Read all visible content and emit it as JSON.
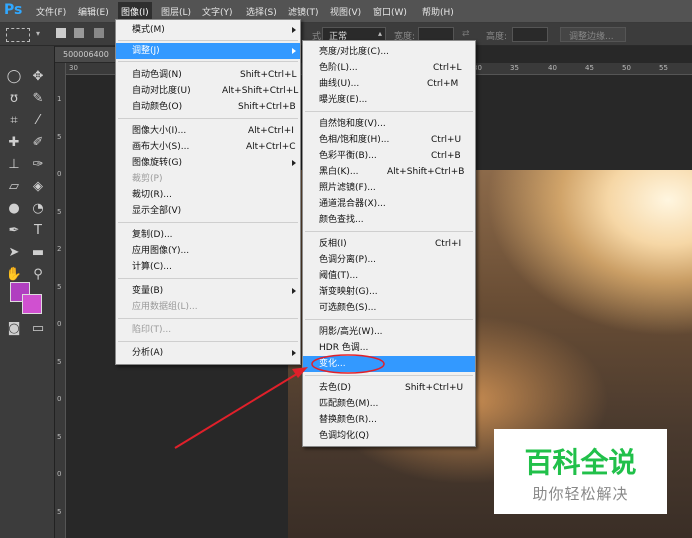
{
  "app": {
    "logo": "Ps"
  },
  "menubar": [
    {
      "label": "文件(F)"
    },
    {
      "label": "编辑(E)"
    },
    {
      "label": "图像(I)"
    },
    {
      "label": "图层(L)"
    },
    {
      "label": "文字(Y)"
    },
    {
      "label": "选择(S)"
    },
    {
      "label": "滤镜(T)"
    },
    {
      "label": "视图(V)"
    },
    {
      "label": "窗口(W)"
    },
    {
      "label": "帮助(H)"
    }
  ],
  "options_bar": {
    "mode_prefix": "式:",
    "mode_value": "正常",
    "width_label": "宽度:",
    "height_label": "高度:",
    "refine_edge": "调整边缘..."
  },
  "document": {
    "tab": "500006400"
  },
  "ruler_h": [
    "30",
    "25",
    "30",
    "35",
    "40",
    "45",
    "50",
    "55"
  ],
  "ruler_v": [
    "1",
    "5",
    "0",
    "5",
    "2",
    "0",
    "5",
    "1",
    "0",
    "1",
    "5",
    "2",
    "0",
    "2",
    "5",
    "3",
    "0",
    "3",
    "5",
    "4",
    "0",
    "4",
    "5",
    "5"
  ],
  "image_menu": {
    "items": [
      {
        "label": "模式(M)",
        "submenu": true
      },
      {
        "label": "调整(J)",
        "submenu": true,
        "highlight": true
      },
      {
        "label": "自动色调(N)",
        "shortcut": "Shift+Ctrl+L"
      },
      {
        "label": "自动对比度(U)",
        "shortcut": "Alt+Shift+Ctrl+L"
      },
      {
        "label": "自动颜色(O)",
        "shortcut": "Shift+Ctrl+B"
      },
      {
        "label": "图像大小(I)...",
        "shortcut": "Alt+Ctrl+I"
      },
      {
        "label": "画布大小(S)...",
        "shortcut": "Alt+Ctrl+C"
      },
      {
        "label": "图像旋转(G)",
        "submenu": true
      },
      {
        "label": "裁剪(P)",
        "disabled": true
      },
      {
        "label": "裁切(R)..."
      },
      {
        "label": "显示全部(V)"
      },
      {
        "label": "复制(D)..."
      },
      {
        "label": "应用图像(Y)..."
      },
      {
        "label": "计算(C)..."
      },
      {
        "label": "变量(B)",
        "submenu": true
      },
      {
        "label": "应用数据组(L)...",
        "disabled": true
      },
      {
        "label": "陷印(T)...",
        "disabled": true
      },
      {
        "label": "分析(A)",
        "submenu": true
      }
    ]
  },
  "adjust_menu": {
    "items": [
      {
        "label": "亮度/对比度(C)..."
      },
      {
        "label": "色阶(L)...",
        "shortcut": "Ctrl+L"
      },
      {
        "label": "曲线(U)...",
        "shortcut": "Ctrl+M"
      },
      {
        "label": "曝光度(E)..."
      },
      {
        "label": "自然饱和度(V)..."
      },
      {
        "label": "色相/饱和度(H)...",
        "shortcut": "Ctrl+U"
      },
      {
        "label": "色彩平衡(B)...",
        "shortcut": "Ctrl+B"
      },
      {
        "label": "黑白(K)...",
        "shortcut": "Alt+Shift+Ctrl+B"
      },
      {
        "label": "照片滤镜(F)..."
      },
      {
        "label": "通道混合器(X)..."
      },
      {
        "label": "颜色查找..."
      },
      {
        "label": "反相(I)",
        "shortcut": "Ctrl+I"
      },
      {
        "label": "色调分离(P)..."
      },
      {
        "label": "阈值(T)..."
      },
      {
        "label": "渐变映射(G)..."
      },
      {
        "label": "可选颜色(S)..."
      },
      {
        "label": "阴影/高光(W)..."
      },
      {
        "label": "HDR 色调..."
      },
      {
        "label": "变化...",
        "highlight": true
      },
      {
        "label": "去色(D)",
        "shortcut": "Shift+Ctrl+U"
      },
      {
        "label": "匹配颜色(M)..."
      },
      {
        "label": "替换颜色(R)..."
      },
      {
        "label": "色调均化(Q)"
      }
    ]
  },
  "watermark": {
    "title": "百科全说",
    "subtitle": "助你轻松解决"
  },
  "colors": {
    "highlight": "#3399ff",
    "annotation": "#e0202a",
    "watermark_green": "#21c04a",
    "fg_swatch": "#b040c0",
    "bg_swatch": "#d050d0"
  }
}
